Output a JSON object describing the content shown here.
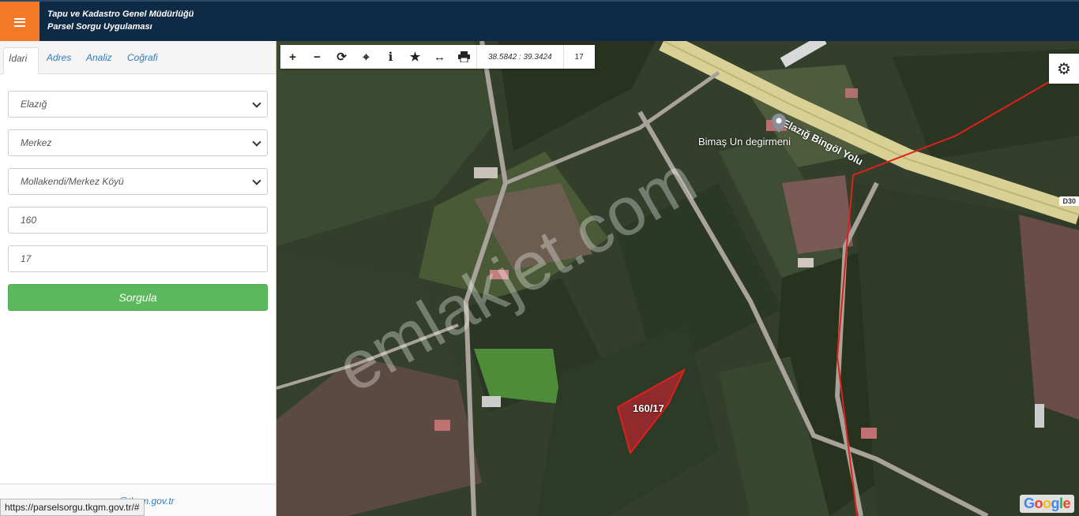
{
  "header": {
    "title_line1": "Tapu ve Kadastro Genel Müdürlüğü",
    "title_line2": "Parsel Sorgu Uygulaması"
  },
  "tabs": [
    "İdari",
    "Adres",
    "Analiz",
    "Coğrafi"
  ],
  "form": {
    "province": "Elazığ",
    "district": "Merkez",
    "neighborhood": "Mollakendi/Merkez Köyü",
    "block": "160",
    "parcel": "17",
    "submit_label": "Sorgula"
  },
  "footer": {
    "link": "...@tkgm.gov.tr"
  },
  "status_url": "https://parselsorgu.tkgm.gov.tr/#",
  "toolbar": {
    "buttons": [
      "zoom-in",
      "zoom-out",
      "refresh",
      "locate",
      "info",
      "favorite",
      "measure",
      "print"
    ],
    "coords": "38.5842 : 39.3424",
    "zoom": "17"
  },
  "map": {
    "watermark": "emlakjet.com",
    "road_label": "Elazığ Bingöl Yolu",
    "poi_label": "Bimaş Un degirmeni",
    "parcel_label": "160/17",
    "road_shield": "D30",
    "attribution": "Google",
    "colors": {
      "parcel_fill": "#b3262e",
      "boundary": "#e0201b",
      "highway": "#d8d095"
    }
  }
}
